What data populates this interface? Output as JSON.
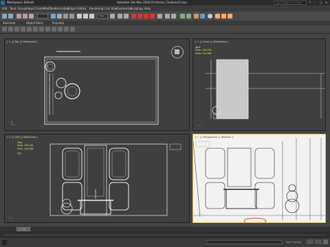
{
  "app": {
    "workspace": "Workspace: Default",
    "title": "Autodesk 3ds Max 2016    Christmas_Fireplace2.max",
    "search_placeholder": "Type a keyword or phrase",
    "menu": [
      "Edit",
      "Tools",
      "Group",
      "Views",
      "Create",
      "Modifiers",
      "Animation",
      "Graph Editors",
      "Rendering",
      "Civil View",
      "Customize",
      "Scripting",
      "Help"
    ],
    "selection_dropdown": "View",
    "ribbon_labels": [
      "Selection",
      "Object Paint",
      "Populate"
    ],
    "viewports": {
      "top": {
        "label": "[ + ] [ Top ] [ Wireframe ]"
      },
      "front": {
        "label": "[ + ] [ Front ] [ Wireframe ]"
      },
      "left": {
        "label": "[ + ] [ Left ] [ Wireframe ]"
      },
      "persp": {
        "label": "[ + ] [ Perspective ] [ Realistic ]"
      }
    },
    "stats": {
      "header": "Total",
      "polys_label": "Polys:",
      "verts_label": "Verts:",
      "polys": "396,230",
      "verts": "220,968",
      "fps_label": "FPS:"
    },
    "timeline": {
      "frame": "0 / 100"
    },
    "status": {
      "grid": "Grid = 10,0cm"
    },
    "colors": {
      "active_border": "#d8c050",
      "stat_text": "#e8e050",
      "select_red": "#e04040"
    }
  }
}
